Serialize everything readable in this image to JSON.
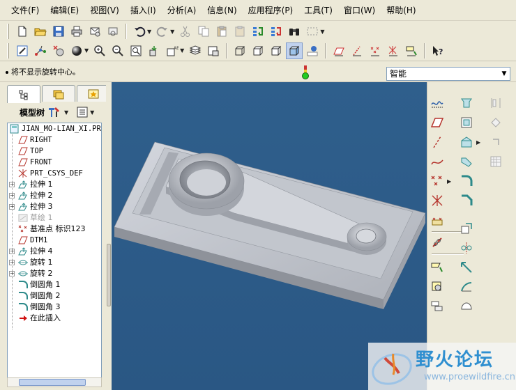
{
  "menu": {
    "items": [
      "文件(F)",
      "编辑(E)",
      "视图(V)",
      "插入(I)",
      "分析(A)",
      "信息(N)",
      "应用程序(P)",
      "工具(T)",
      "窗口(W)",
      "帮助(H)"
    ]
  },
  "status": {
    "message": "将不显示旋转中心。",
    "filter_value": "智能"
  },
  "model_tree": {
    "title": "模型树",
    "rows": [
      {
        "label": "JIAN_MO-LIAN_XI.PRT",
        "icon": "part-icon",
        "expandable": false
      },
      {
        "label": "RIGHT",
        "icon": "datum-plane-icon",
        "expandable": false
      },
      {
        "label": "TOP",
        "icon": "datum-plane-icon",
        "expandable": false
      },
      {
        "label": "FRONT",
        "icon": "datum-plane-icon",
        "expandable": false
      },
      {
        "label": "PRT_CSYS_DEF",
        "icon": "coordinate-system-icon",
        "expandable": false
      },
      {
        "label": "拉伸 1",
        "icon": "extrude-icon",
        "expandable": true
      },
      {
        "label": "拉伸 2",
        "icon": "extrude-icon",
        "expandable": true
      },
      {
        "label": "拉伸 3",
        "icon": "extrude-icon",
        "expandable": true
      },
      {
        "label": "草绘 1",
        "icon": "sketch-icon",
        "expandable": false,
        "dim": true
      },
      {
        "label": "基准点 标识123",
        "icon": "datum-point-icon",
        "expandable": false
      },
      {
        "label": "DTM1",
        "icon": "datum-plane-icon",
        "expandable": false
      },
      {
        "label": "拉伸 4",
        "icon": "extrude-icon",
        "expandable": true
      },
      {
        "label": "旋转 1",
        "icon": "revolve-icon",
        "expandable": true
      },
      {
        "label": "旋转 2",
        "icon": "revolve-icon",
        "expandable": true
      },
      {
        "label": "倒圆角 1",
        "icon": "round-icon",
        "expandable": false
      },
      {
        "label": "倒圆角 2",
        "icon": "round-icon",
        "expandable": false
      },
      {
        "label": "倒圆角 3",
        "icon": "round-icon",
        "expandable": false
      },
      {
        "label": "在此插入",
        "icon": "insert-here-arrow-icon",
        "expandable": false
      }
    ]
  },
  "watermark": {
    "cn": "野火论坛",
    "url": "www.proewildfire.cn"
  },
  "colors": {
    "viewport_bg": "#2d5b88",
    "part_fill": "#b8bcc4",
    "accent_blue": "#2f8fd0"
  }
}
